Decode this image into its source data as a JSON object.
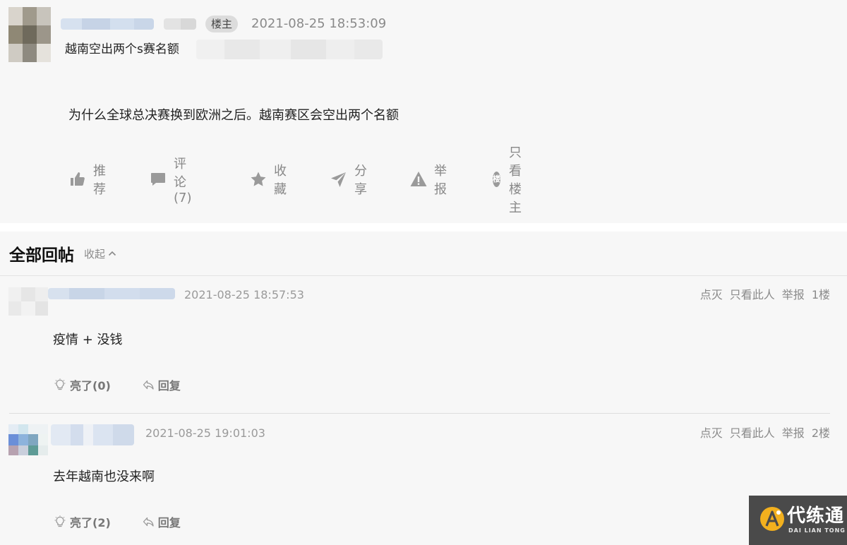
{
  "op": {
    "badge": "楼主",
    "time": "2021-08-25 18:53:09",
    "title": "越南空出两个s赛名额",
    "body": "为什么全球总决赛换到欧洲之后。越南赛区会空出两个名额",
    "actions": {
      "recommend": "推荐",
      "comment": "评论 (7)",
      "favorite": "收藏",
      "share": "分享",
      "report": "举报",
      "only_op_glyph": "楼",
      "only_op": "只看楼主"
    }
  },
  "replies_section": {
    "title": "全部回帖",
    "collapse": "收起"
  },
  "replies": [
    {
      "time": "2021-08-25 18:57:53",
      "tools": {
        "dislike": "点灭",
        "only_this": "只看此人",
        "report": "举报",
        "floor": "1楼"
      },
      "text": "疫情 + 没钱",
      "light": "亮了(0)",
      "reply": "回复"
    },
    {
      "time": "2021-08-25 19:01:03",
      "tools": {
        "dislike": "点灭",
        "only_this": "只看此人",
        "report": "举报",
        "floor": "2楼"
      },
      "text": "去年越南也没来啊",
      "light": "亮了(2)",
      "reply": "回复"
    }
  ],
  "watermark": {
    "name": "代练通",
    "sub": "DAI LIAN TONG"
  },
  "colors": {
    "background": "#f7f7f7",
    "muted_text": "#8a8a8a",
    "watermark_bg": "#4a4a4a",
    "watermark_accent": "#f2b01e"
  }
}
